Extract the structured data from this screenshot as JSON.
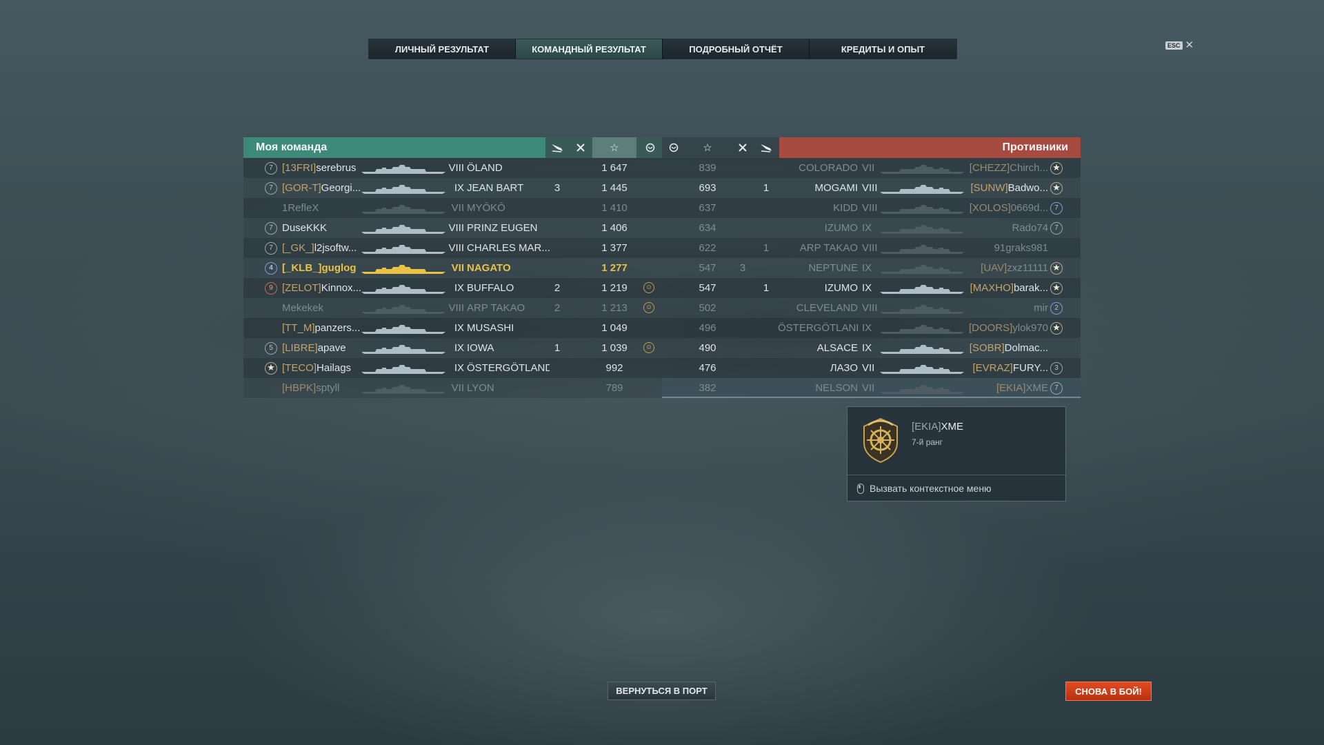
{
  "tabs": [
    {
      "label": "ЛИЧНЫЙ РЕЗУЛЬТАТ"
    },
    {
      "label": "КОМАНДНЫЙ РЕЗУЛЬТАТ"
    },
    {
      "label": "ПОДРОБНЫЙ ОТЧЁТ"
    },
    {
      "label": "КРЕДИТЫ И ОПЫТ"
    }
  ],
  "active_tab": 1,
  "esc": {
    "key": "ESC",
    "close": "✕"
  },
  "my_team": {
    "title": "Моя команда",
    "header_icons": [
      "plane-kill-icon",
      "frag-icon",
      "star-icon",
      "medal-icon"
    ],
    "rows": [
      {
        "rank": "7",
        "clan": "[13FRI]",
        "name": "serebrus",
        "tier": "VIII",
        "ship": "ÖLAND",
        "planes": "",
        "frags": "",
        "score": "1 647",
        "medal": false,
        "dead": false
      },
      {
        "rank": "7",
        "clan": "[GOR-T]",
        "name": "Georgi...",
        "tier": "IX",
        "ship": "JEAN BART",
        "planes": "3",
        "frags": "",
        "score": "1 445",
        "medal": false,
        "dead": false
      },
      {
        "rank": "",
        "clan": "",
        "name": "1RefleX",
        "tier": "VII",
        "ship": "MYŌKŌ",
        "planes": "",
        "frags": "",
        "score": "1 410",
        "medal": false,
        "dead": true
      },
      {
        "rank": "7",
        "clan": "",
        "name": "DuseKKK",
        "tier": "VIII",
        "ship": "PRINZ EUGEN",
        "planes": "",
        "frags": "",
        "score": "1 406",
        "medal": false,
        "dead": false
      },
      {
        "rank": "7",
        "clan": "[_GK_]",
        "name": "l2jsoftw...",
        "tier": "VIII",
        "ship": "CHARLES MAR...",
        "planes": "",
        "frags": "",
        "score": "1 377",
        "medal": false,
        "dead": false
      },
      {
        "rank": "4",
        "clan": "[_KLB_]",
        "name": "guglog",
        "tier": "VII",
        "ship": "NAGATO",
        "planes": "",
        "frags": "",
        "score": "1 277",
        "medal": false,
        "dead": false,
        "me": true
      },
      {
        "rank": "9",
        "clan": "[ZELOT]",
        "name": "Kinnox...",
        "tier": "IX",
        "ship": "BUFFALO",
        "planes": "2",
        "frags": "",
        "score": "1 219",
        "medal": true,
        "dead": false
      },
      {
        "rank": "",
        "clan": "",
        "name": "Mekekek",
        "tier": "VIII",
        "ship": "ARP TAKAO",
        "planes": "2",
        "frags": "",
        "score": "1 213",
        "medal": true,
        "dead": true
      },
      {
        "rank": "",
        "clan": "[TT_M]",
        "name": "panzers...",
        "tier": "IX",
        "ship": "MUSASHI",
        "planes": "",
        "frags": "",
        "score": "1 049",
        "medal": false,
        "dead": false
      },
      {
        "rank": "5",
        "clan": "[LIBRE]",
        "name": "apave",
        "tier": "IX",
        "ship": "IOWA",
        "planes": "1",
        "frags": "",
        "score": "1 039",
        "medal": true,
        "dead": false
      },
      {
        "rank": "★",
        "clan": "[TECO]",
        "name": "Hailags",
        "tier": "IX",
        "ship": "ÖSTERGÖTLAND",
        "planes": "",
        "frags": "",
        "score": "992",
        "medal": false,
        "dead": false
      },
      {
        "rank": "",
        "clan": "[HBPK]",
        "name": "sptyll",
        "tier": "VII",
        "ship": "LYON",
        "planes": "",
        "frags": "",
        "score": "789",
        "medal": false,
        "dead": true
      }
    ]
  },
  "enemy_team": {
    "title": "Противники",
    "header_icons": [
      "medal-icon",
      "star-icon",
      "frag-icon",
      "plane-kill-icon"
    ],
    "rows": [
      {
        "score": "839",
        "frags": "",
        "planes": "",
        "ship": "COLORADO",
        "tier": "VII",
        "clan": "[CHEZZ]",
        "name": "Chirch...",
        "rank": "★",
        "dead": true
      },
      {
        "score": "693",
        "frags": "",
        "planes": "1",
        "ship": "MOGAMI",
        "tier": "VIII",
        "clan": "[SUNW]",
        "name": "Badwo...",
        "rank": "★",
        "dead": false
      },
      {
        "score": "637",
        "frags": "",
        "planes": "",
        "ship": "KIDD",
        "tier": "VIII",
        "clan": "[XOLOS]",
        "name": "0669d...",
        "rank": "7",
        "dead": true,
        "blue": true
      },
      {
        "score": "634",
        "frags": "",
        "planes": "",
        "ship": "IZUMO",
        "tier": "IX",
        "clan": "",
        "name": "Rado74",
        "rank": "7",
        "dead": true
      },
      {
        "score": "622",
        "frags": "",
        "planes": "1",
        "ship": "ARP TAKAO",
        "tier": "VIII",
        "clan": "",
        "name": "91graks981",
        "rank": "",
        "dead": true
      },
      {
        "score": "547",
        "frags": "3",
        "planes": "",
        "ship": "NEPTUNE",
        "tier": "IX",
        "clan": "[UAV]",
        "name": "zxz11111",
        "rank": "★",
        "dead": true
      },
      {
        "score": "547",
        "frags": "",
        "planes": "1",
        "ship": "IZUMO",
        "tier": "IX",
        "clan": "[MAXHO]",
        "name": "barak...",
        "rank": "★",
        "dead": false
      },
      {
        "score": "502",
        "frags": "",
        "planes": "",
        "ship": "CLEVELAND",
        "tier": "VIII",
        "clan": "",
        "name": "mir",
        "rank": "2",
        "dead": true,
        "blue": true
      },
      {
        "score": "496",
        "frags": "",
        "planes": "",
        "ship": "ÖSTERGÖTLAND",
        "tier": "IX",
        "clan": "[DOORS]",
        "name": "ylok970",
        "rank": "★",
        "dead": true
      },
      {
        "score": "490",
        "frags": "",
        "planes": "",
        "ship": "ALSACE",
        "tier": "IX",
        "clan": "[SOBR]",
        "name": "Dolmac...",
        "rank": "",
        "dead": false
      },
      {
        "score": "476",
        "frags": "",
        "planes": "",
        "ship": "ЛАЗО",
        "tier": "VII",
        "clan": "[EVRAZ]",
        "name": "FURY...",
        "rank": "3",
        "dead": false
      },
      {
        "score": "382",
        "frags": "",
        "planes": "",
        "ship": "NELSON",
        "tier": "VII",
        "clan": "[EKIA]",
        "name": "XME",
        "rank": "7",
        "dead": true,
        "selected": true
      }
    ]
  },
  "tooltip": {
    "clan": "[EKIA]",
    "name": "XME",
    "rank": "7-й ранг",
    "action": "Вызвать контекстное меню"
  },
  "buttons": {
    "port": "ВЕРНУТЬСЯ В ПОРТ",
    "battle": "СНОВА В БОЙ!"
  },
  "colors": {
    "my_team": "#3d8a7a",
    "enemy_team": "#a74a3f",
    "player_highlight": "#e9c243",
    "battle_button": "#d4401a"
  }
}
